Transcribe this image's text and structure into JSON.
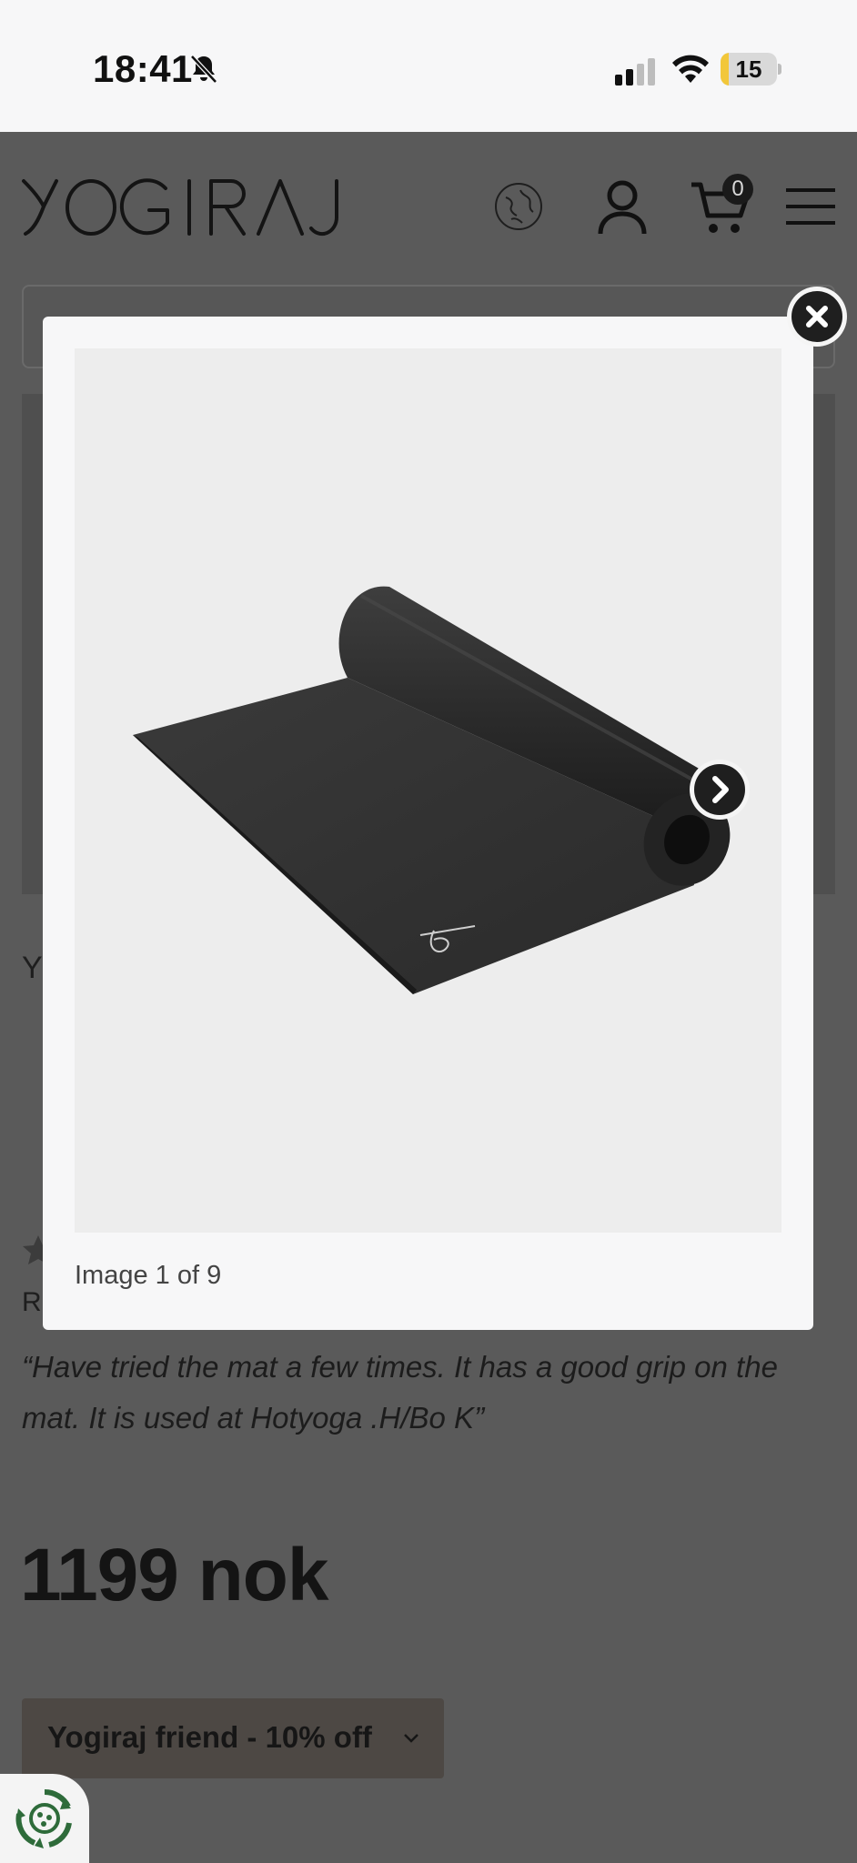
{
  "status_bar": {
    "time": "18:41",
    "battery": "15",
    "battery_percent": 15
  },
  "header": {
    "logo": "YOGIRAJ",
    "cart_count": "0",
    "icons": [
      "globe-icon",
      "user-icon",
      "cart-icon",
      "menu-icon"
    ]
  },
  "page": {
    "partial_text_y": "Y",
    "partial_text_r": "R",
    "review": "“Have tried the mat a few times. It has a good grip on the mat. It is used at Hotyoga .H/Bo K”",
    "price": "1199 nok",
    "friend_option": "Yogiraj friend - 10% off"
  },
  "lightbox": {
    "caption": "Image 1 of 9",
    "image_subject": "black yoga mat, partially rolled",
    "colors": {
      "mat": "#2a2a2a",
      "image_bg": "#ededed"
    }
  },
  "colors": {
    "overlay": "#5a5a5a",
    "modal_bg": "#f7f7f8",
    "eco_green": "#2e6b3a"
  }
}
